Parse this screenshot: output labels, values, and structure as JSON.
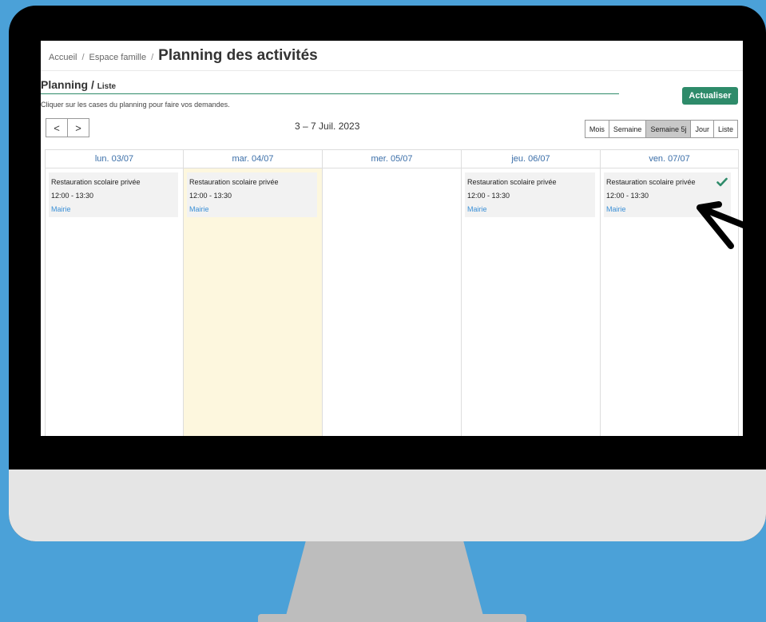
{
  "breadcrumb": {
    "home": "Accueil",
    "family": "Espace famille",
    "current": "Planning des activités"
  },
  "planning": {
    "title": "Planning /",
    "view_label": "Liste",
    "refresh_label": "Actualiser",
    "hint": "Cliquer sur les cases du planning pour faire vos demandes."
  },
  "nav": {
    "prev": "<",
    "next": ">"
  },
  "date_range": "3 – 7 Juil. 2023",
  "views": [
    "Mois",
    "Semaine",
    "Semaine 5j",
    "Jour",
    "Liste"
  ],
  "active_view": "Semaine 5j",
  "days": [
    {
      "label": "lun. 03/07"
    },
    {
      "label": "mar. 04/07"
    },
    {
      "label": "mer. 05/07"
    },
    {
      "label": "jeu. 06/07"
    },
    {
      "label": "ven. 07/07"
    }
  ],
  "events": {
    "mon": {
      "title": "Restauration scolaire privée",
      "time": "12:00 - 13:30",
      "location": "Mairie"
    },
    "tue": {
      "title": "Restauration scolaire privée",
      "time": "12:00 - 13:30",
      "location": "Mairie"
    },
    "thu": {
      "title": "Restauration scolaire privée",
      "time": "12:00 - 13:30",
      "location": "Mairie"
    },
    "fri": {
      "title": "Restauration scolaire privée",
      "time": "12:00 - 13:30",
      "location": "Mairie",
      "status_icon": "check-icon"
    }
  },
  "colors": {
    "accent": "#2e8b6a",
    "today": "#fdf7de",
    "link": "#3a8fd6",
    "day_header": "#3a6ea8",
    "background": "#4ba1d8"
  }
}
